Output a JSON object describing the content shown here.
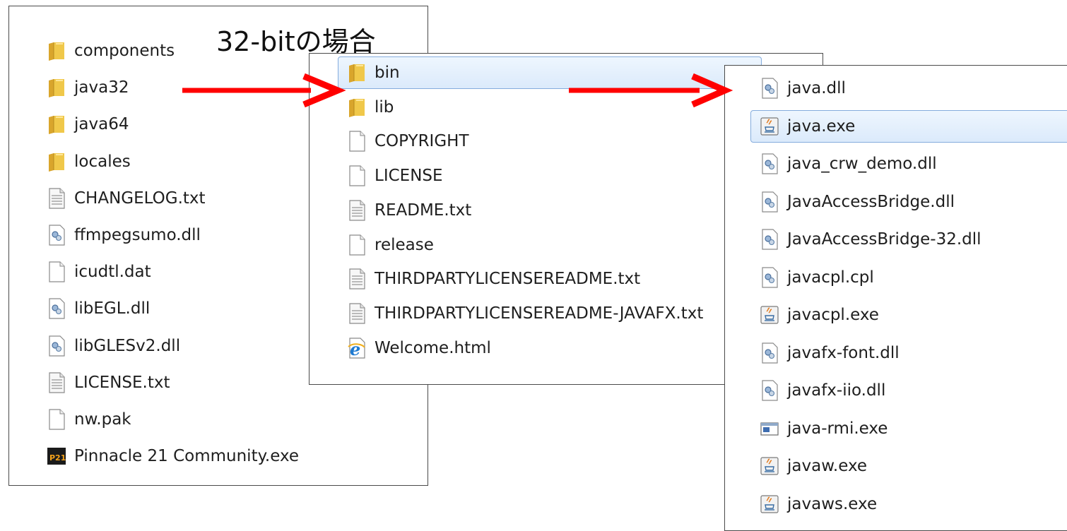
{
  "annotation": {
    "title": "32-bitの場合",
    "arrow_color": "#ff0000"
  },
  "colors": {
    "folder": "#f0c84a",
    "selection_border": "#84acdd",
    "selection_fill": "#dbeafb"
  },
  "panel_root": {
    "items": [
      {
        "label": "components",
        "icon": "folder-icon"
      },
      {
        "label": "java32",
        "icon": "folder-icon"
      },
      {
        "label": "java64",
        "icon": "folder-icon"
      },
      {
        "label": "locales",
        "icon": "folder-icon"
      },
      {
        "label": "CHANGELOG.txt",
        "icon": "text-file-icon"
      },
      {
        "label": "ffmpegsumo.dll",
        "icon": "dll-file-icon"
      },
      {
        "label": "icudtl.dat",
        "icon": "blank-file-icon"
      },
      {
        "label": "libEGL.dll",
        "icon": "dll-file-icon"
      },
      {
        "label": "libGLESv2.dll",
        "icon": "dll-file-icon"
      },
      {
        "label": "LICENSE.txt",
        "icon": "text-file-icon"
      },
      {
        "label": "nw.pak",
        "icon": "blank-file-icon"
      },
      {
        "label": "Pinnacle 21 Community.exe",
        "icon": "p21-app-icon",
        "icon_text": "P21"
      }
    ]
  },
  "panel_java32": {
    "items": [
      {
        "label": "bin",
        "icon": "folder-icon",
        "selected": true
      },
      {
        "label": "lib",
        "icon": "folder-icon"
      },
      {
        "label": "COPYRIGHT",
        "icon": "blank-file-icon"
      },
      {
        "label": "LICENSE",
        "icon": "blank-file-icon"
      },
      {
        "label": "README.txt",
        "icon": "text-file-icon"
      },
      {
        "label": "release",
        "icon": "blank-file-icon"
      },
      {
        "label": "THIRDPARTYLICENSEREADME.txt",
        "icon": "text-file-icon"
      },
      {
        "label": "THIRDPARTYLICENSEREADME-JAVAFX.txt",
        "icon": "text-file-icon"
      },
      {
        "label": "Welcome.html",
        "icon": "ie-html-icon"
      }
    ]
  },
  "panel_bin": {
    "items": [
      {
        "label": "java.dll",
        "icon": "dll-file-icon"
      },
      {
        "label": "java.exe",
        "icon": "java-exe-icon",
        "selected": true
      },
      {
        "label": "java_crw_demo.dll",
        "icon": "dll-file-icon"
      },
      {
        "label": "JavaAccessBridge.dll",
        "icon": "dll-file-icon"
      },
      {
        "label": "JavaAccessBridge-32.dll",
        "icon": "dll-file-icon"
      },
      {
        "label": "javacpl.cpl",
        "icon": "dll-file-icon"
      },
      {
        "label": "javacpl.exe",
        "icon": "java-exe-icon"
      },
      {
        "label": "javafx-font.dll",
        "icon": "dll-file-icon"
      },
      {
        "label": "javafx-iio.dll",
        "icon": "dll-file-icon"
      },
      {
        "label": "java-rmi.exe",
        "icon": "window-exe-icon"
      },
      {
        "label": "javaw.exe",
        "icon": "java-exe-icon"
      },
      {
        "label": "javaws.exe",
        "icon": "java-exe-icon"
      }
    ]
  }
}
